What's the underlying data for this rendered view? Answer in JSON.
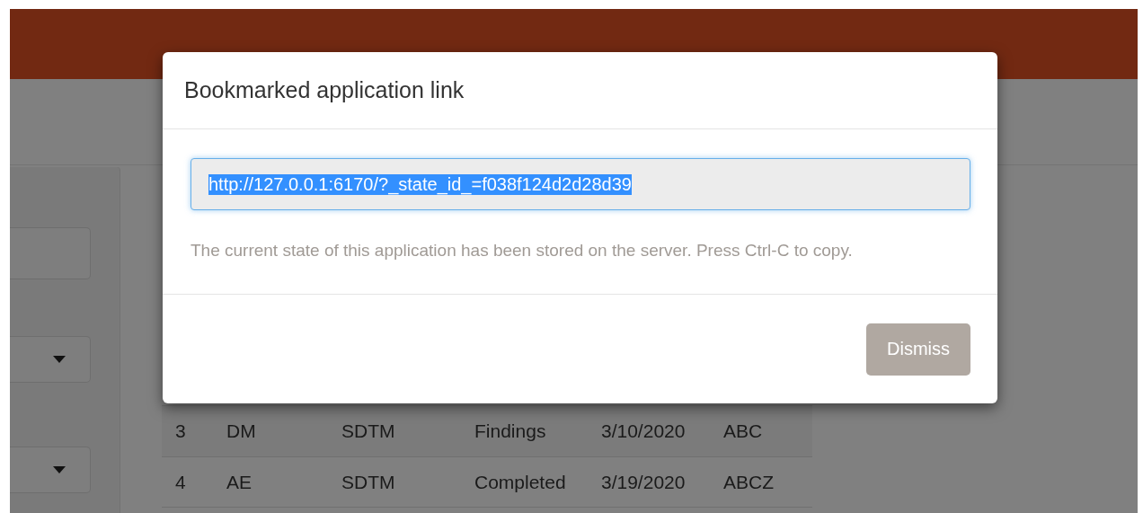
{
  "dialog": {
    "title": "Bookmarked application link",
    "link_field": {
      "value": "http://127.0.0.1:6170/?_state_id_=f038f124d2d28d39",
      "selected": true
    },
    "help_text": "The current state of this application has been stored on the server. Press Ctrl-C to copy.",
    "buttons": [
      {
        "label": "Dismiss"
      }
    ]
  },
  "table": {
    "rows": [
      {
        "cells": [
          "3",
          "DM",
          "SDTM",
          "Findings",
          "3/10/2020",
          "ABC"
        ]
      },
      {
        "cells": [
          "4",
          "AE",
          "SDTM",
          "Completed",
          "3/19/2020",
          "ABCZ"
        ]
      }
    ]
  }
}
